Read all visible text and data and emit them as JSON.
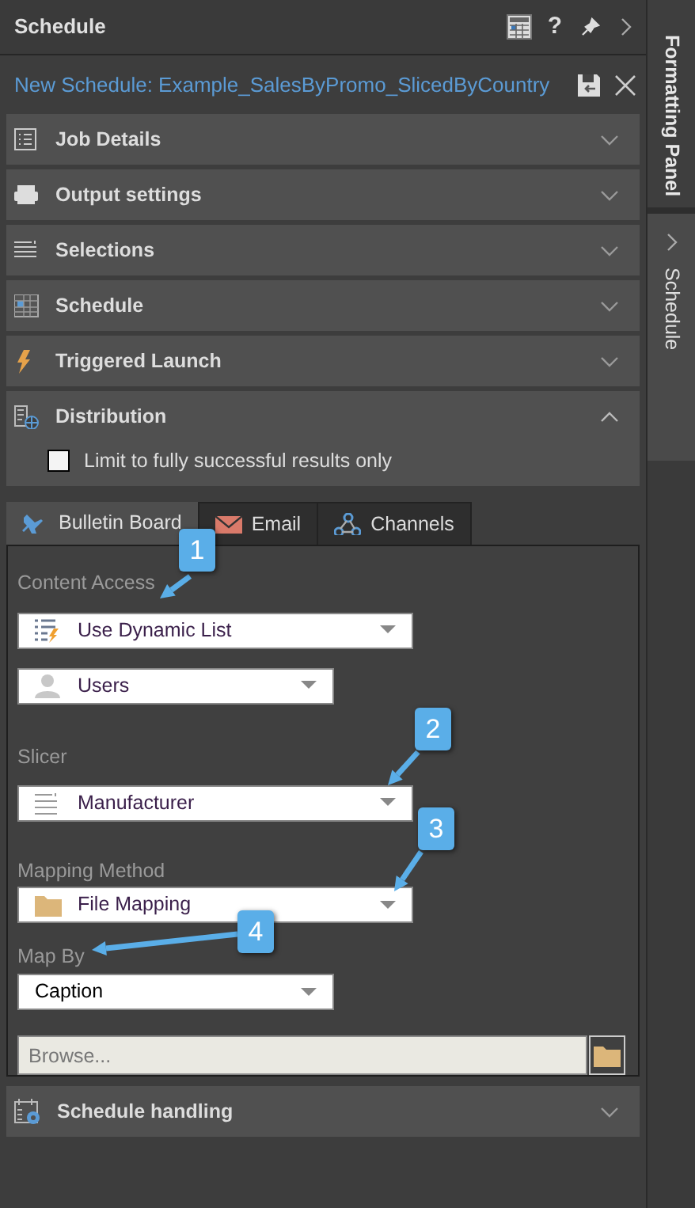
{
  "header": {
    "title": "Schedule",
    "help": "?"
  },
  "schedule_title": "New Schedule: Example_SalesByPromo_SlicedByCountry",
  "sections": [
    {
      "label": "Job Details",
      "expanded": false
    },
    {
      "label": "Output settings",
      "expanded": false
    },
    {
      "label": "Selections",
      "expanded": false
    },
    {
      "label": "Schedule",
      "expanded": false
    },
    {
      "label": "Triggered Launch",
      "expanded": false
    },
    {
      "label": "Distribution",
      "expanded": true,
      "checkbox": {
        "label": "Limit to fully successful results only",
        "checked": false
      }
    }
  ],
  "tabs": [
    {
      "label": "Bulletin Board",
      "selected": true
    },
    {
      "label": "Email",
      "selected": false
    },
    {
      "label": "Channels",
      "selected": false
    }
  ],
  "form": [
    {
      "kind": "label",
      "text": "Content Access"
    },
    {
      "kind": "dropdown",
      "value": "Use Dynamic List"
    },
    {
      "kind": "dropdown",
      "value": "Users"
    },
    {
      "kind": "label",
      "text": "Slicer"
    },
    {
      "kind": "dropdown",
      "value": "Manufacturer"
    },
    {
      "kind": "label",
      "text": "Mapping Method"
    },
    {
      "kind": "dropdown",
      "value": "File Mapping"
    },
    {
      "kind": "label",
      "text": "Map By"
    },
    {
      "kind": "dropdown",
      "value": "Caption"
    },
    {
      "kind": "file",
      "placeholder": "Browse..."
    }
  ],
  "footer_section": {
    "label": "Schedule handling",
    "expanded": false
  },
  "side_tabs": [
    {
      "label": "Formatting Panel"
    },
    {
      "label": "Schedule"
    }
  ],
  "callouts": [
    {
      "number": "1"
    },
    {
      "number": "2"
    },
    {
      "number": "3"
    },
    {
      "number": "4"
    }
  ]
}
